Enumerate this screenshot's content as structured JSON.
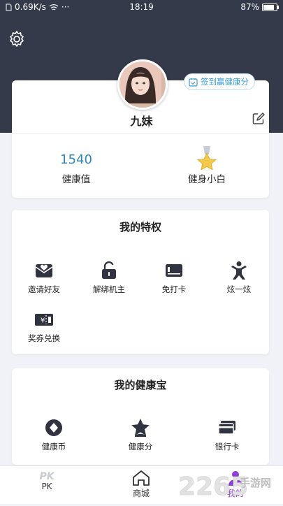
{
  "status_bar": {
    "network_speed": "0.69K/s",
    "dots": "···",
    "time": "18:19",
    "battery": "87%"
  },
  "header": {
    "checkin_label": "签到赢健康分",
    "username": "九妹"
  },
  "stats": [
    {
      "value": "1540",
      "label": "健康值"
    },
    {
      "value": "",
      "label": "健身小白",
      "icon": "medal-star-icon"
    }
  ],
  "privileges": {
    "title": "我的特权",
    "items": [
      {
        "label": "邀请好友",
        "icon": "invite-envelope-icon"
      },
      {
        "label": "解绑机主",
        "icon": "unlock-icon"
      },
      {
        "label": "免打卡",
        "icon": "card-icon"
      },
      {
        "label": "炫一炫",
        "icon": "show-off-person-icon"
      },
      {
        "label": "奖券兑换",
        "icon": "coupon-icon"
      }
    ]
  },
  "treasury": {
    "title": "我的健康宝",
    "items": [
      {
        "label": "健康币",
        "icon": "coin-icon"
      },
      {
        "label": "健康分",
        "icon": "star-points-icon"
      },
      {
        "label": "银行卡",
        "icon": "bank-card-icon"
      }
    ]
  },
  "tabs": [
    {
      "logo": "PK",
      "label": "PK"
    },
    {
      "label": "商城"
    },
    {
      "label": "我的"
    }
  ],
  "watermark": {
    "number": "2265",
    "site": "手游网"
  },
  "colors": {
    "header_bg": "#353a4a",
    "accent_blue": "#2d85b8",
    "active_tab": "#8a3fd1"
  }
}
